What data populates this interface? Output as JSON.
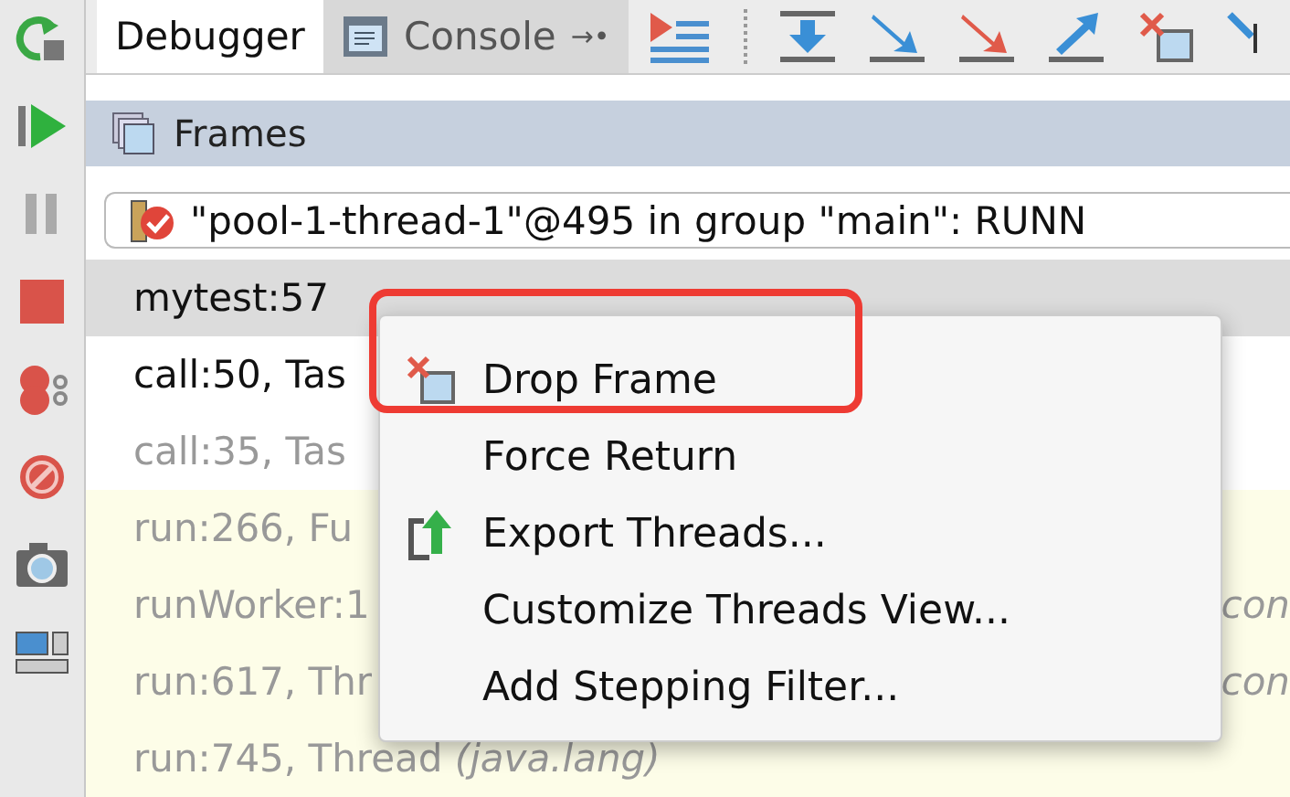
{
  "side_toolbar": [
    {
      "kind": "rerun"
    },
    {
      "kind": "resume"
    },
    {
      "kind": "pause"
    },
    {
      "kind": "stop"
    },
    {
      "kind": "breakpoints"
    },
    {
      "kind": "mute"
    },
    {
      "kind": "camera"
    },
    {
      "kind": "layout"
    }
  ],
  "tabs": [
    {
      "label": "Debugger",
      "selected": true
    },
    {
      "label": "Console",
      "selected": false,
      "pin": "→•"
    }
  ],
  "toolbar": [
    {
      "kind": "show-execution"
    },
    {
      "kind": "step-over"
    },
    {
      "kind": "step-into"
    },
    {
      "kind": "force-step-into"
    },
    {
      "kind": "step-out"
    },
    {
      "kind": "drop-frame"
    },
    {
      "kind": "run-to-cursor"
    }
  ],
  "frames_header": "Frames",
  "thread": "\"pool-1-thread-1\"@495 in group \"main\": RUNN",
  "frames": [
    {
      "text": "mytest:57",
      "kind": "user",
      "selected": true
    },
    {
      "text": "call:50, Tas",
      "kind": "user",
      "selected": false
    },
    {
      "text": "call:35, Tas",
      "kind": "library",
      "selected": false
    },
    {
      "text": "run:266, Fu",
      "kind": "async",
      "selected": false
    },
    {
      "text": "runWorker:1",
      "tail": "con",
      "kind": "async",
      "selected": false
    },
    {
      "text": "run:617, Thr",
      "tail": "con",
      "kind": "async",
      "selected": false
    },
    {
      "text": "run:745, Thread *(java.lang)*",
      "kind": "async",
      "selected": false
    }
  ],
  "context_menu": {
    "items": [
      {
        "label": "Drop Frame",
        "kind": "drop",
        "highlighted": true
      },
      {
        "label": "Force Return"
      },
      {
        "label": "Export Threads...",
        "kind": "export"
      },
      {
        "label": "Customize Threads View..."
      },
      {
        "label": "Add Stepping Filter..."
      }
    ]
  }
}
